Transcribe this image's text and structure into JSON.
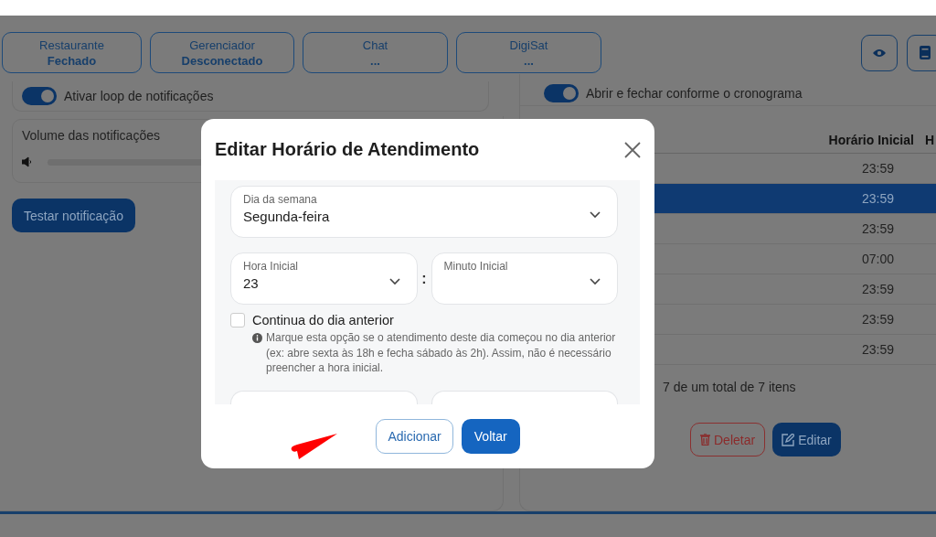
{
  "status_cards": [
    {
      "label": "Restaurante",
      "value": "Fechado"
    },
    {
      "label": "Gerenciador",
      "value": "Desconectado"
    },
    {
      "label": "Chat",
      "value": "..."
    },
    {
      "label": "DigiSat",
      "value": "..."
    }
  ],
  "left_panel": {
    "loop_toggle": {
      "label": "Ativar loop de notificações",
      "on": true
    },
    "volume": {
      "label": "Volume das notificações"
    },
    "test_button": "Testar notificação"
  },
  "right_panel": {
    "schedule_toggle": {
      "label": "Abrir e fechar conforme o cronograma",
      "on": true
    },
    "table": {
      "columns": [
        "Horário Inicial",
        "H"
      ],
      "rows": [
        {
          "cells": [
            "23:59"
          ],
          "selected": false
        },
        {
          "cells": [
            "23:59"
          ],
          "selected": true
        },
        {
          "cells": [
            "23:59"
          ],
          "selected": false
        },
        {
          "cells": [
            "07:00"
          ],
          "selected": false
        },
        {
          "cells": [
            "23:59"
          ],
          "selected": false
        },
        {
          "cells": [
            "23:59"
          ],
          "selected": false
        },
        {
          "cells": [
            "23:59"
          ],
          "selected": false
        }
      ]
    },
    "pagination": "7 de um total de 7 itens",
    "buttons": [
      {
        "kind": "danger",
        "label": "Deletar"
      },
      {
        "kind": "primary",
        "label": "Editar"
      }
    ]
  },
  "dialog": {
    "title": "Editar Horário de Atendimento",
    "day_field": {
      "label": "Dia da semana",
      "value": "Segunda-feira"
    },
    "hour_field": {
      "label": "Hora Inicial",
      "value": "23"
    },
    "separator": ":",
    "minute_field": {
      "label": "Minuto Inicial"
    },
    "continue_checkbox": {
      "label": "Continua do dia anterior",
      "checked": false
    },
    "hint": "Marque esta opção se o atendimento deste dia começou no dia anterior (ex: abre sexta às 18h e fecha sábado às 2h). Assim, não é necessário preencher a hora inicial.",
    "buttons": [
      {
        "kind": "outline",
        "label": "Adicionar"
      },
      {
        "kind": "primary",
        "label": "Voltar"
      }
    ]
  }
}
